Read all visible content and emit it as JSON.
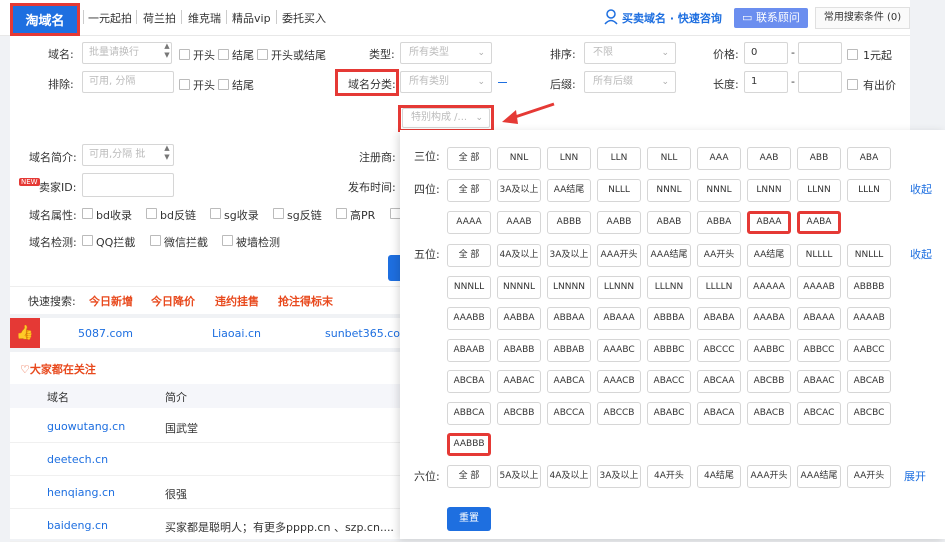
{
  "header": {
    "logo": "淘域名",
    "nav": [
      "一元起拍",
      "荷兰拍",
      "维克瑞",
      "精品vip",
      "委托买入"
    ],
    "buy_text": "买卖域名 · 快速咨询",
    "contact_button": "联系顾问",
    "common_search": "常用搜索条件 (0)"
  },
  "filters": {
    "domain_label": "域名:",
    "domain_placeholder": "批量请换行",
    "start": "开头",
    "end": "结尾",
    "start_or_end": "开头或结尾",
    "type_label": "类型:",
    "type_placeholder": "所有类型",
    "sort_label": "排序:",
    "sort_value": "不限",
    "price_label": "价格:",
    "price_min": "0",
    "price_dash": "-",
    "one_yuan": "1元起",
    "exclude_label": "排除:",
    "exclude_placeholder": "可用, 分隔",
    "category_label": "域名分类:",
    "category_placeholder": "所有类别",
    "suffix_label": "后缀:",
    "suffix_placeholder": "所有后缀",
    "length_label": "长度:",
    "length_min": "1",
    "has_price": "有出价",
    "special_placeholder": "特别构成 /...",
    "intro_label": "域名简介:",
    "intro_placeholder": "可用,分隔 批",
    "registrar_label": "注册商:",
    "new_badge": "NEW",
    "seller_label": "卖家ID:",
    "publish_label": "发布时间:",
    "attr_label": "域名属性:",
    "attrs": [
      "bd收录",
      "bd反链",
      "sg收录",
      "sg反链",
      "高PR"
    ],
    "detect_label": "域名检测:",
    "detects": [
      "QQ拦截",
      "微信拦截",
      "被墙检测"
    ]
  },
  "quick": {
    "label": "快速搜索:",
    "items": [
      "今日新增",
      "今日降价",
      "违约挂售",
      "抢注得标末"
    ]
  },
  "links": [
    "5087.com",
    "Liaoai.cn",
    "sunbet365.co"
  ],
  "attention": {
    "title": "大家都在关注",
    "col_domain": "域名",
    "col_desc": "简介",
    "rows": [
      {
        "domain": "guowutang.cn",
        "desc": "国武堂"
      },
      {
        "domain": "deetech.cn",
        "desc": ""
      },
      {
        "domain": "henqiang.cn",
        "desc": "很强"
      },
      {
        "domain": "baideng.cn",
        "desc": "买家都是聪明人；有更多pppp.cn 、szp.cn...."
      }
    ]
  },
  "popup": {
    "labels": {
      "three": "三位:",
      "four": "四位:",
      "five": "五位:",
      "six": "六位:"
    },
    "collapse": "收起",
    "expand": "展开",
    "reset": "重置",
    "three": [
      "全 部",
      "NNL",
      "LNN",
      "LLN",
      "NLL",
      "AAA",
      "AAB",
      "ABB",
      "ABA"
    ],
    "four": [
      "全 部",
      "3A及以上",
      "AA结尾",
      "NLLL",
      "NNNL",
      "NNNL",
      "LNNN",
      "LLNN",
      "LLLN",
      "AAAA",
      "AAAB",
      "ABBB",
      "AABB",
      "ABAB",
      "ABBA",
      "ABAA",
      "AABA"
    ],
    "five": [
      "全 部",
      "4A及以上",
      "3A及以上",
      "AAA开头",
      "AAA结尾",
      "AA开头",
      "AA结尾",
      "NLLLL",
      "NNLLL",
      "NNNLL",
      "NNNNL",
      "LNNNN",
      "LLNNN",
      "LLLNN",
      "LLLLN",
      "AAAAA",
      "AAAAB",
      "ABBBB",
      "AAABB",
      "AABBA",
      "ABBAA",
      "ABAAA",
      "ABBBA",
      "ABABA",
      "AAABA",
      "ABAAA",
      "AAAAB",
      "ABAAB",
      "ABABB",
      "ABBAB",
      "AAABC",
      "ABBBC",
      "ABCCC",
      "AABBC",
      "ABBCC",
      "AABCC",
      "ABCBA",
      "AABAC",
      "AABCA",
      "AAACB",
      "ABACC",
      "ABCAA",
      "ABCBB",
      "ABAAC",
      "ABCAB",
      "ABBCA",
      "ABCBB",
      "ABCCA",
      "ABCCB",
      "ABABC",
      "ABACA",
      "ABACB",
      "ABCAC",
      "ABCBC",
      "AABBB"
    ],
    "six": [
      "全 部",
      "5A及以上",
      "4A及以上",
      "3A及以上",
      "4A开头",
      "4A结尾",
      "AAA开头",
      "AAA结尾",
      "AA开头"
    ]
  }
}
